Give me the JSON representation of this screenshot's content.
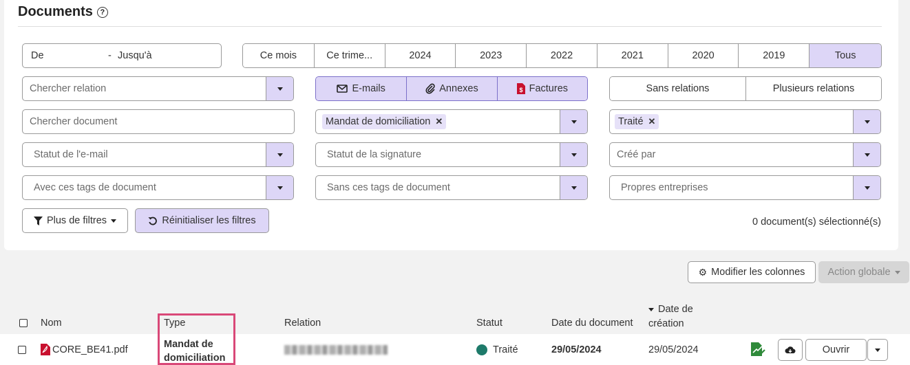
{
  "page": {
    "title": "Documents"
  },
  "date_range": {
    "from": "De",
    "separator": "-",
    "to": "Jusqu'à"
  },
  "periods": [
    "Ce mois",
    "Ce trime...",
    "2024",
    "2023",
    "2022",
    "2021",
    "2020",
    "2019",
    "Tous"
  ],
  "selected_period": "Tous",
  "filters": {
    "relation_placeholder": "Chercher relation",
    "document_placeholder": "Chercher document",
    "email_status_placeholder": "Statut de l'e-mail",
    "with_tags_placeholder": "Avec ces tags de document",
    "signature_status_placeholder": "Statut de la signature",
    "without_tags_placeholder": "Sans ces tags de document",
    "created_by_placeholder": "Créé par",
    "own_companies_placeholder": "Propres entreprises",
    "type_chip": "Mandat de domiciliation",
    "status_chip": "Traité"
  },
  "doc_types": [
    "E-mails",
    "Annexes",
    "Factures"
  ],
  "relation_modes": [
    "Sans relations",
    "Plusieurs relations"
  ],
  "actions": {
    "more_filters": "Plus de filtres",
    "reset_filters": "Réinitialiser les filtres",
    "selected_count": "0 document(s) sélectionné(s)",
    "modify_columns": "Modifier les colonnes",
    "global_action": "Action globale"
  },
  "table": {
    "headers": {
      "name": "Nom",
      "type": "Type",
      "relation": "Relation",
      "status": "Statut",
      "doc_date": "Date du document",
      "created_line1": "Date de",
      "created_line2": "création"
    },
    "rows": [
      {
        "name": "CORE_BE41.pdf",
        "type_line1": "Mandat de",
        "type_line2": "domiciliation",
        "status": "Traité",
        "doc_date": "29/05/2024",
        "created": "29/05/2024",
        "open": "Ouvrir"
      }
    ]
  },
  "colors": {
    "accent": "#ddd6f7",
    "accent_border": "#7b6fc9",
    "status_done": "#1e7a6a",
    "highlight": "#d94878",
    "pdf_red": "#c8102e"
  }
}
